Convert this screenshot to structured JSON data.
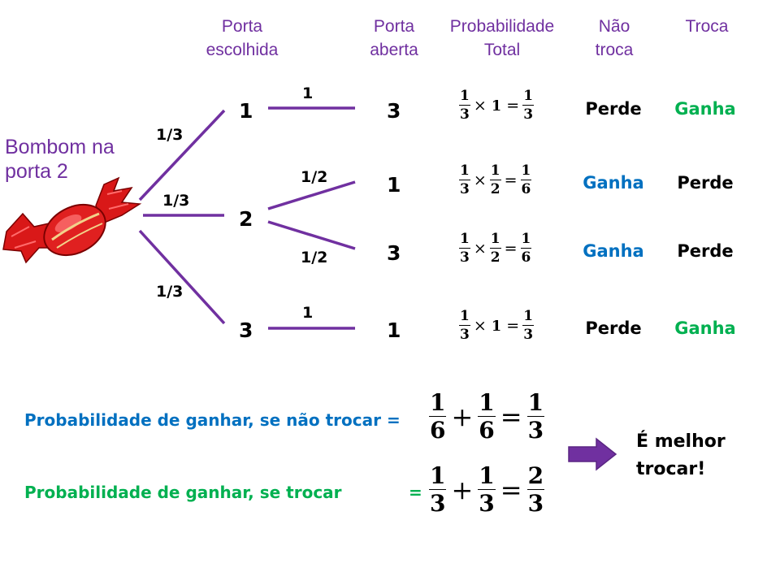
{
  "headers": {
    "chosen_door": [
      "Porta",
      "escolhida"
    ],
    "opened_door": [
      "Porta",
      "aberta"
    ],
    "total_probability": [
      "Probabilidade",
      "Total"
    ],
    "no_switch": [
      "Não",
      "troca"
    ],
    "switch": "Troca"
  },
  "candy_label": [
    "Bombom na",
    "porta 2"
  ],
  "tree": {
    "first_branch_probs": [
      "1/3",
      "1/3",
      "1/3"
    ],
    "chosen_nodes": [
      "1",
      "2",
      "3"
    ],
    "second_branch_probs": [
      "1",
      "1/2",
      "1/2",
      "1"
    ],
    "opened_nodes": [
      "3",
      "1",
      "3",
      "1"
    ]
  },
  "rows": [
    {
      "eq": {
        "a_num": "1",
        "a_den": "3",
        "times": "×",
        "b": "1",
        "eqsign": "=",
        "r_num": "1",
        "r_den": "3"
      },
      "no_switch": "Perde",
      "switch": "Ganha"
    },
    {
      "eq": {
        "a_num": "1",
        "a_den": "3",
        "times": "×",
        "b_num": "1",
        "b_den": "2",
        "eqsign": "=",
        "r_num": "1",
        "r_den": "6"
      },
      "no_switch": "Ganha",
      "switch": "Perde"
    },
    {
      "eq": {
        "a_num": "1",
        "a_den": "3",
        "times": "×",
        "b_num": "1",
        "b_den": "2",
        "eqsign": "=",
        "r_num": "1",
        "r_den": "6"
      },
      "no_switch": "Ganha",
      "switch": "Perde"
    },
    {
      "eq": {
        "a_num": "1",
        "a_den": "3",
        "times": "×",
        "b": "1",
        "eqsign": "=",
        "r_num": "1",
        "r_den": "3"
      },
      "no_switch": "Perde",
      "switch": "Ganha"
    }
  ],
  "summary": {
    "no_switch_text": "Probabilidade de ganhar, se não trocar =",
    "no_switch_eq": {
      "a_num": "1",
      "a_den": "6",
      "plus": "+",
      "b_num": "1",
      "b_den": "6",
      "eqsign": "=",
      "r_num": "1",
      "r_den": "3"
    },
    "switch_text": "Probabilidade de ganhar, se trocar",
    "switch_eqsign_prefix": "=",
    "switch_eq": {
      "a_num": "1",
      "a_den": "3",
      "plus": "+",
      "b_num": "1",
      "b_den": "3",
      "eqsign": "=",
      "r_num": "2",
      "r_den": "3"
    }
  },
  "conclusion": [
    "É melhor",
    "trocar!"
  ],
  "colors": {
    "purple": "#7030a0",
    "blue": "#0070c0",
    "green": "#00b050",
    "candy_red": "#e02020"
  },
  "icons": {
    "candy": "candy-icon",
    "arrow": "right-arrow-icon"
  }
}
